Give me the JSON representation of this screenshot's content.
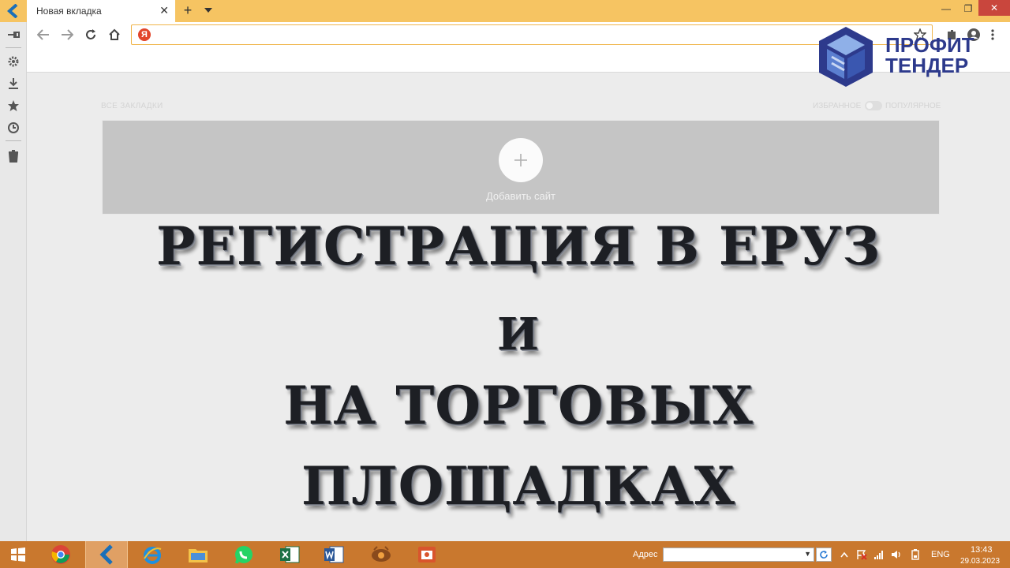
{
  "browser": {
    "tab_title": "Новая вкладка",
    "tab_close": "✕",
    "tab_add": "+",
    "address_value": "",
    "search_engine_badge": "Я"
  },
  "window_controls": {
    "minimize": "—",
    "restore": "❐",
    "close": "✕"
  },
  "page": {
    "all_bookmarks_label": "ВСЕ ЗАКЛАДКИ",
    "favorites_label": "ИЗБРАННОЕ",
    "popular_label": "ПОПУЛЯРНОЕ",
    "add_site_label": "Добавить сайт"
  },
  "overlay_title": {
    "line1": "РЕГИСТРАЦИЯ В ЕРУЗ",
    "line2": "И",
    "line3": "НА ТОРГОВЫХ",
    "line4": "ПЛОЩАДКАХ"
  },
  "brand": {
    "line1": "ПРОФИТ",
    "line2": "ТЕНДЕР",
    "color": "#2d3a8c"
  },
  "taskbar": {
    "address_label": "Адрес",
    "address_value": "",
    "language": "ENG",
    "time": "13:43",
    "date": "29.03.2023",
    "apps": [
      "windows-start-icon",
      "chrome-icon",
      "browser-icon",
      "internet-explorer-icon",
      "file-explorer-icon",
      "whatsapp-icon",
      "excel-icon",
      "word-icon",
      "media-player-icon",
      "photo-app-icon"
    ]
  },
  "colors": {
    "titlebar": "#f6c462",
    "taskbar": "#c9782e",
    "address_border": "#f0b54b",
    "yandex_red": "#e2452b"
  }
}
